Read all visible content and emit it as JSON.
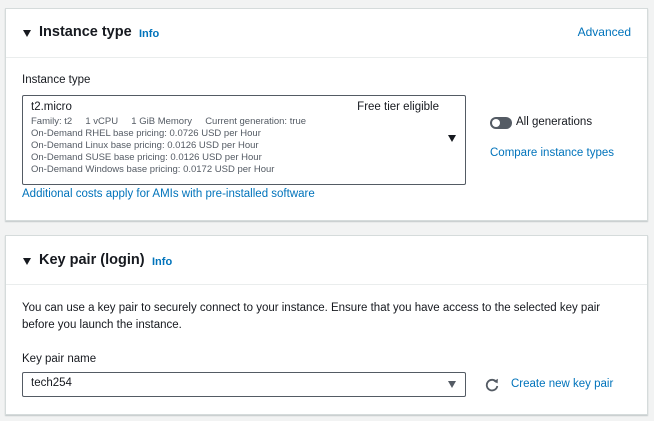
{
  "instance_type_panel": {
    "title": "Instance type",
    "info_label": "Info",
    "advanced_label": "Advanced",
    "field_label": "Instance type",
    "selected": {
      "name": "t2.micro",
      "free_tier": "Free tier eligible",
      "details": "Family: t2     1 vCPU     1 GiB Memory     Current generation: true",
      "pricing_rhel": "On-Demand RHEL base pricing: 0.0726 USD per Hour",
      "pricing_linux": "On-Demand Linux base pricing: 0.0126 USD per Hour",
      "pricing_suse": "On-Demand SUSE base pricing: 0.0126 USD per Hour",
      "pricing_windows": "On-Demand Windows base pricing: 0.0172 USD per Hour"
    },
    "all_generations_label": "All generations",
    "all_generations_enabled": false,
    "compare_link": "Compare instance types",
    "additional_costs_link": "Additional costs apply for AMIs with pre-installed software"
  },
  "key_pair_panel": {
    "title": "Key pair (login)",
    "info_label": "Info",
    "description": "You can use a key pair to securely connect to your instance. Ensure that you have access to the selected key pair before you launch the instance.",
    "field_label": "Key pair name",
    "selected_value": "tech254",
    "create_link": "Create new key pair"
  },
  "colors": {
    "link": "#0073bb",
    "text": "#16191f",
    "border": "#545b64",
    "background": "#f2f3f3"
  },
  "icons": [
    "collapse-caret-icon",
    "dropdown-caret-icon",
    "refresh-icon",
    "toggle-switch"
  ]
}
